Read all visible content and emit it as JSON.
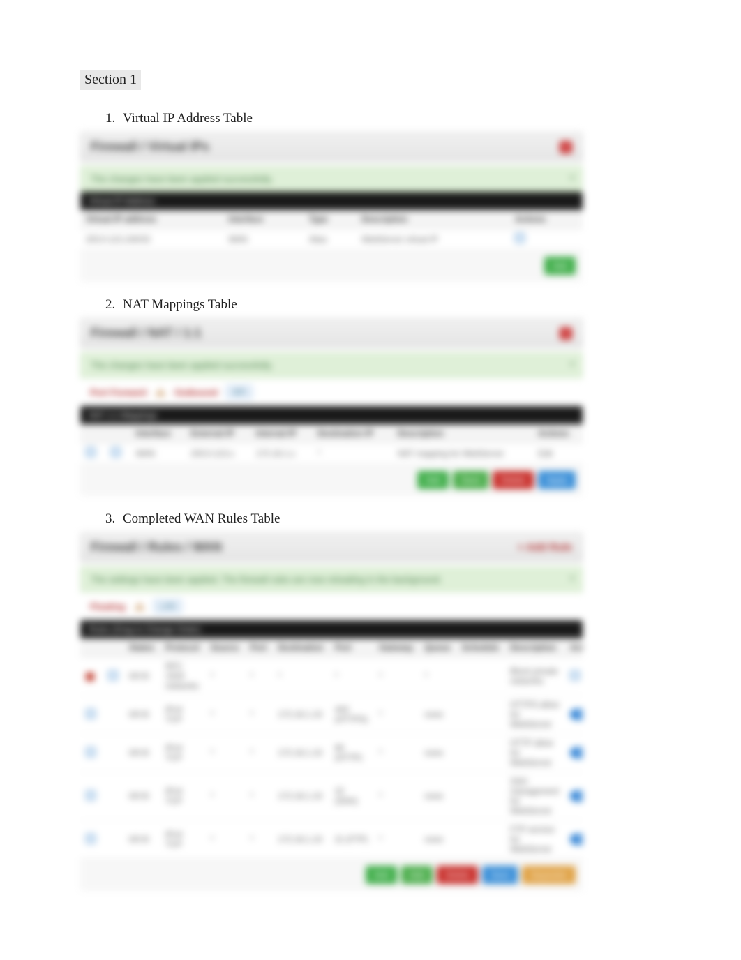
{
  "section_heading": "Section 1",
  "items": [
    {
      "label": "Virtual IP Address Table"
    },
    {
      "label": "NAT Mappings Table"
    },
    {
      "label": "Completed WAN Rules Table"
    }
  ],
  "panel1": {
    "title": "Firewall / Virtual IPs",
    "close": "×",
    "alert": "The changes have been applied successfully.",
    "alert_close": "×",
    "table_caption": "Virtual IP Address",
    "headers": [
      "Virtual IP address",
      "Interface",
      "Type",
      "Description",
      "Actions"
    ],
    "row": {
      "ip": "203.0.113.100/32",
      "iface": "WAN",
      "type": "Alias",
      "desc": "WebServer virtual IP",
      "action": "Edit"
    },
    "add_btn": "Add"
  },
  "panel2": {
    "title": "Firewall / NAT / 1:1",
    "close": "×",
    "alert": "The changes have been applied successfully.",
    "alert_close": "×",
    "tabs": {
      "portfwd": "Port Forward",
      "oneone": "1:1",
      "outbound": "Outbound",
      "npt": "NPt"
    },
    "table_caption": "NAT 1:1 Mappings",
    "headers": [
      "",
      "",
      "Interface",
      "External IP",
      "Internal IP",
      "Destination IP",
      "Description",
      "Actions"
    ],
    "row": {
      "iface": "WAN",
      "ext": "203.0.113.x",
      "int": "172.16.1.x",
      "dest": "*",
      "desc": "NAT mapping for WebServer",
      "action": "Edit"
    },
    "buttons": {
      "add": "Add",
      "save": "Save",
      "delete": "Delete",
      "apply": "Apply"
    }
  },
  "panel3": {
    "title": "Firewall / Rules / WAN",
    "caption": "+ Add Rule",
    "alert": "The settings have been applied. The firewall rules are now reloading in the background.",
    "alert_close": "×",
    "tabs": {
      "floating": "Floating",
      "wan": "WAN",
      "lan": "LAN"
    },
    "table_caption": "Rules (Drag to Change Order)",
    "headers": [
      "",
      "",
      "States",
      "Protocol",
      "Source",
      "Port",
      "Destination",
      "Port",
      "Gateway",
      "Queue",
      "Schedule",
      "Description",
      "Actions"
    ],
    "filter_row": {
      "states": "0/0 B",
      "protocol": "RFC 1918 networks",
      "source": "*",
      "port": "*",
      "dest": "*",
      "dport": "*",
      "gateway": "*",
      "queue": "*",
      "desc": "Block private networks"
    },
    "rows": [
      {
        "states": "0/0 B",
        "proto": "IPv4 TCP",
        "src": "*",
        "sport": "*",
        "dest": "172.16.1.10",
        "dport": "443 (HTTPS)",
        "gw": "*",
        "q": "none",
        "desc": "HTTPS allow for WebServer",
        "action": "Edit/Copy"
      },
      {
        "states": "0/0 B",
        "proto": "IPv4 TCP",
        "src": "*",
        "sport": "*",
        "dest": "172.16.1.10",
        "dport": "80 (HTTP)",
        "gw": "*",
        "q": "none",
        "desc": "HTTP allow for WebServer",
        "action": "Edit/Copy"
      },
      {
        "states": "0/0 B",
        "proto": "IPv4 TCP",
        "src": "*",
        "sport": "*",
        "dest": "172.16.1.10",
        "dport": "22 (SSH)",
        "gw": "*",
        "q": "none",
        "desc": "SSH management for WebServer",
        "action": "Edit/Copy"
      },
      {
        "states": "0/0 B",
        "proto": "IPv4 TCP",
        "src": "*",
        "sport": "*",
        "dest": "172.16.1.10",
        "dport": "21 (FTP)",
        "gw": "*",
        "q": "none",
        "desc": "FTP service for WebServer",
        "action": "Edit/Copy"
      }
    ],
    "buttons": {
      "add1": "Add",
      "add2": "Add",
      "delete": "Delete",
      "save": "Save",
      "sep": "Separator"
    }
  }
}
